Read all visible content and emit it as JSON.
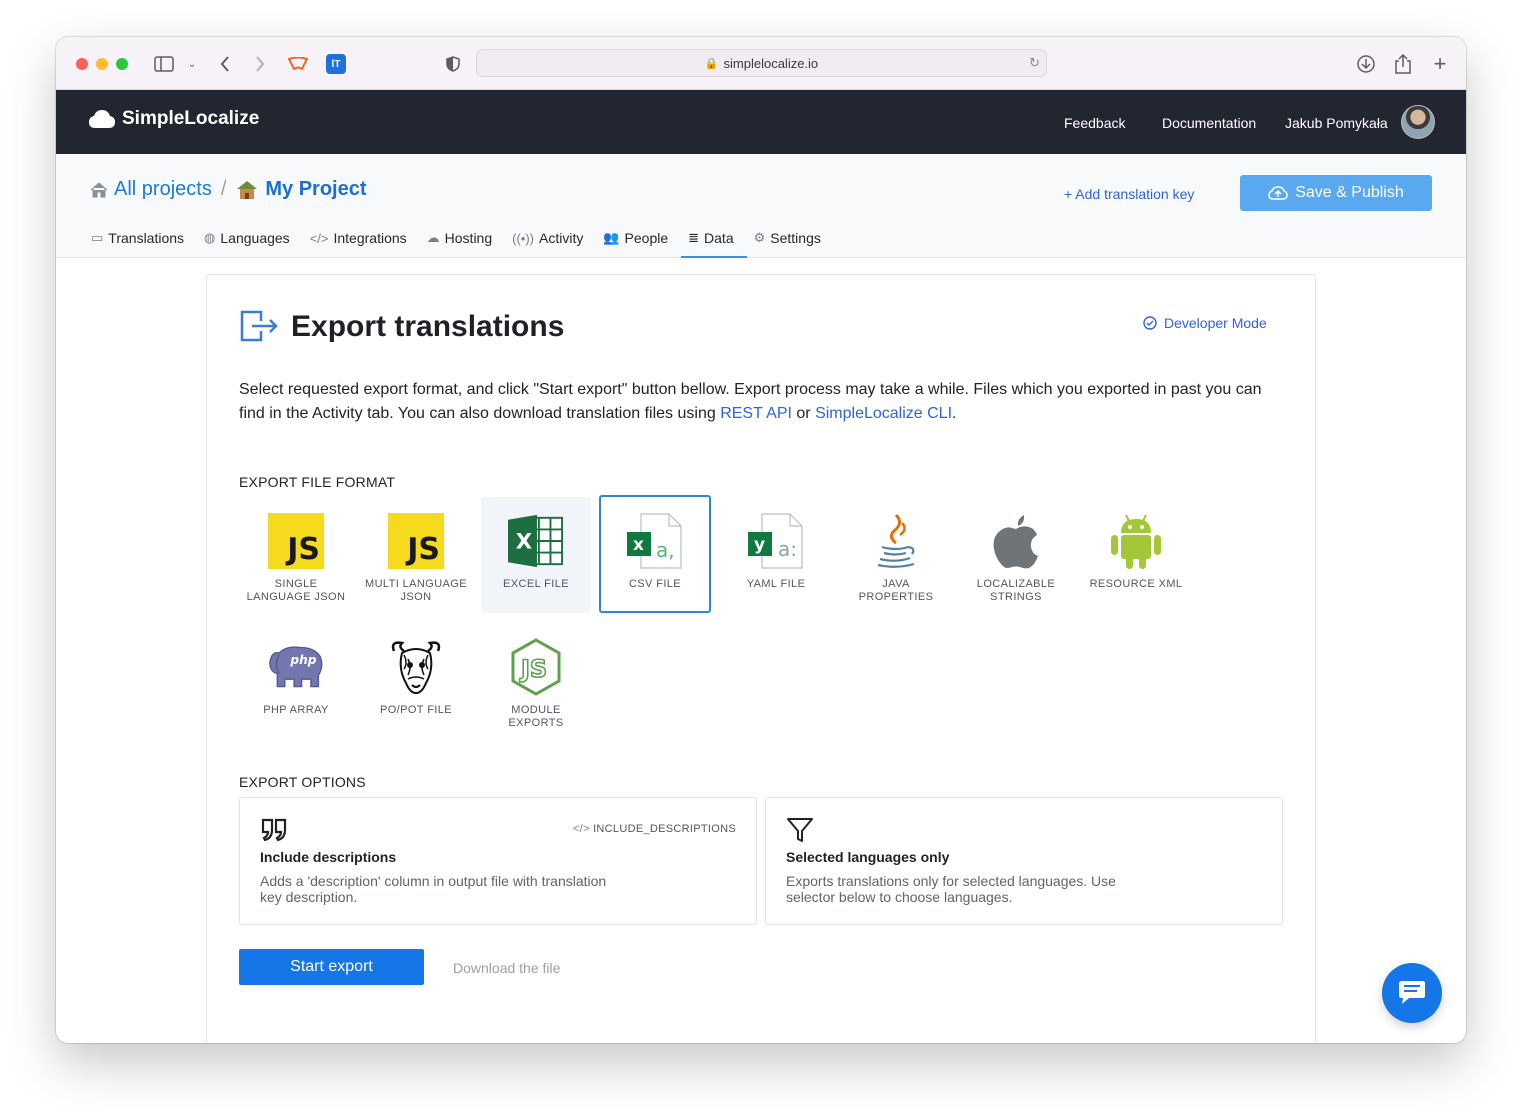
{
  "browser": {
    "url": "simplelocalize.io"
  },
  "header": {
    "brand": "SimpleLocalize",
    "nav": [
      "Feedback",
      "Documentation"
    ],
    "user_name": "Jakub Pomykała"
  },
  "project": {
    "breadcrumb_root": "All projects",
    "breadcrumb_sep": "/",
    "project_name": "My Project",
    "add_key_label": "+ Add translation key",
    "save_label": "Save & Publish",
    "tabs": [
      {
        "label": "Translations",
        "icon": "translations-icon"
      },
      {
        "label": "Languages",
        "icon": "globe-icon"
      },
      {
        "label": "Integrations",
        "icon": "code-icon"
      },
      {
        "label": "Hosting",
        "icon": "cloud-icon"
      },
      {
        "label": "Activity",
        "icon": "broadcast-icon"
      },
      {
        "label": "People",
        "icon": "people-icon"
      },
      {
        "label": "Data",
        "icon": "database-icon",
        "active": true
      },
      {
        "label": "Settings",
        "icon": "gear-icon"
      }
    ]
  },
  "export": {
    "title": "Export translations",
    "developer_mode": "Developer Mode",
    "intro_text": "Select requested export format, and click \"Start export\" button bellow. Export process may take a while. Files which you exported in past you can find in the Activity tab. You can also download translation files using ",
    "intro_link1": "REST API",
    "intro_or": " or ",
    "intro_link2": "SimpleLocalize CLI",
    "intro_end": ".",
    "format_section": "EXPORT FILE FORMAT",
    "formats": [
      {
        "label": "Single language JSON",
        "icon": "javascript-icon"
      },
      {
        "label": "Multi language JSON",
        "icon": "javascript-icon"
      },
      {
        "label": "Excel file",
        "icon": "excel-icon",
        "state": "hover"
      },
      {
        "label": "CSV file",
        "icon": "csv-icon",
        "state": "selected"
      },
      {
        "label": "YAML file",
        "icon": "yaml-icon"
      },
      {
        "label": "Java properties",
        "icon": "java-icon"
      },
      {
        "label": "Localizable strings",
        "icon": "apple-icon"
      },
      {
        "label": "Resource XML",
        "icon": "android-icon"
      },
      {
        "label": "PHP Array",
        "icon": "php-icon"
      },
      {
        "label": "PO/POT file",
        "icon": "gnu-icon"
      },
      {
        "label": "Module exports",
        "icon": "nodejs-icon"
      }
    ],
    "options_section": "EXPORT OPTIONS",
    "options": [
      {
        "title": "Include descriptions",
        "desc": "Adds a 'description' column in output file with translation key description.",
        "tag": "INCLUDE_DESCRIPTIONS",
        "icon": "quote-icon"
      },
      {
        "title": "Selected languages only",
        "desc": "Exports translations only for selected languages. Use selector below to choose languages.",
        "icon": "filter-icon"
      }
    ],
    "start_label": "Start export",
    "download_label": "Download the file"
  },
  "colors": {
    "brand_dark": "#212630",
    "primary": "#1576e8",
    "link": "#2f63d9",
    "save_button": "#5aa9f0"
  }
}
